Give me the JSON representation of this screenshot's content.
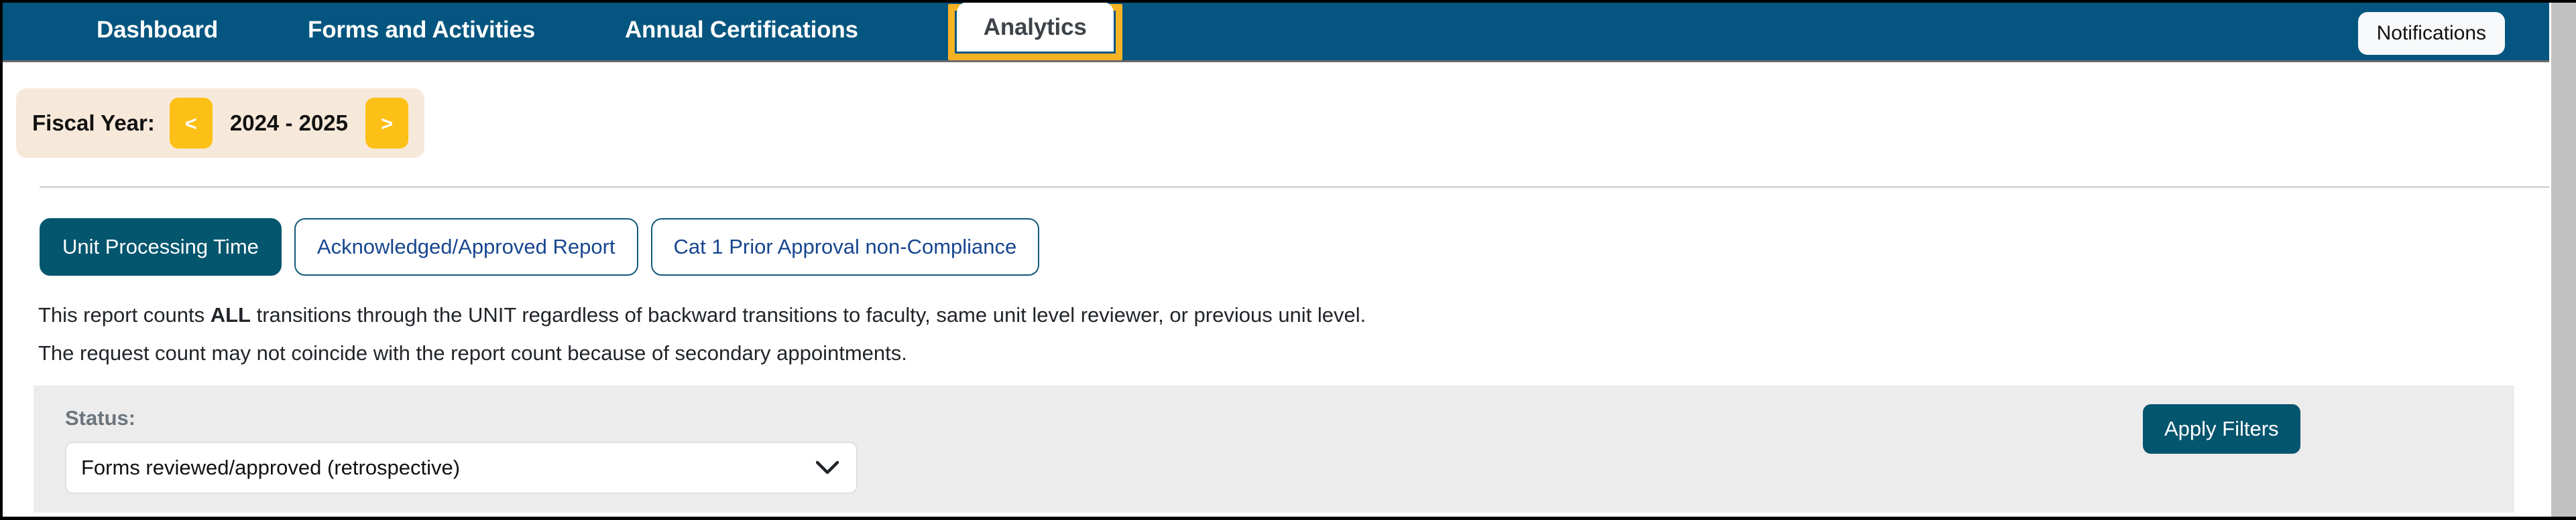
{
  "navbar": {
    "tabs": [
      {
        "label": "Dashboard",
        "active": false
      },
      {
        "label": "Forms and Activities",
        "active": false
      },
      {
        "label": "Annual Certifications",
        "active": false
      },
      {
        "label": "Analytics",
        "active": true
      }
    ],
    "notifications_label": "Notifications",
    "background_color": "#04557f",
    "focus_outline_color": "#f5b324"
  },
  "fiscal_year": {
    "label": "Fiscal Year:",
    "prev_label": "<",
    "next_label": ">",
    "value": "2024 - 2025",
    "panel_color": "#f7e9da",
    "arrow_color": "#fdc016"
  },
  "report_tabs": [
    {
      "label": "Unit Processing Time",
      "selected": true
    },
    {
      "label": "Acknowledged/Approved Report",
      "selected": false
    },
    {
      "label": "Cat 1 Prior Approval non-Compliance",
      "selected": false
    }
  ],
  "description": {
    "line1_prefix": "This report counts ",
    "line1_bold": "ALL",
    "line1_suffix": " transitions through the UNIT regardless of backward transitions to faculty, same unit level reviewer, or previous unit level.",
    "line2": "The request count may not coincide with the report count because of secondary appointments."
  },
  "filters": {
    "status_label": "Status:",
    "status_value": "Forms reviewed/approved (retrospective)",
    "status_options": [
      "Forms reviewed/approved (retrospective)"
    ],
    "chevron_icon": "chevron-down-icon",
    "apply_label": "Apply Filters",
    "panel_color": "#ececec",
    "accent_color": "#04556e"
  }
}
